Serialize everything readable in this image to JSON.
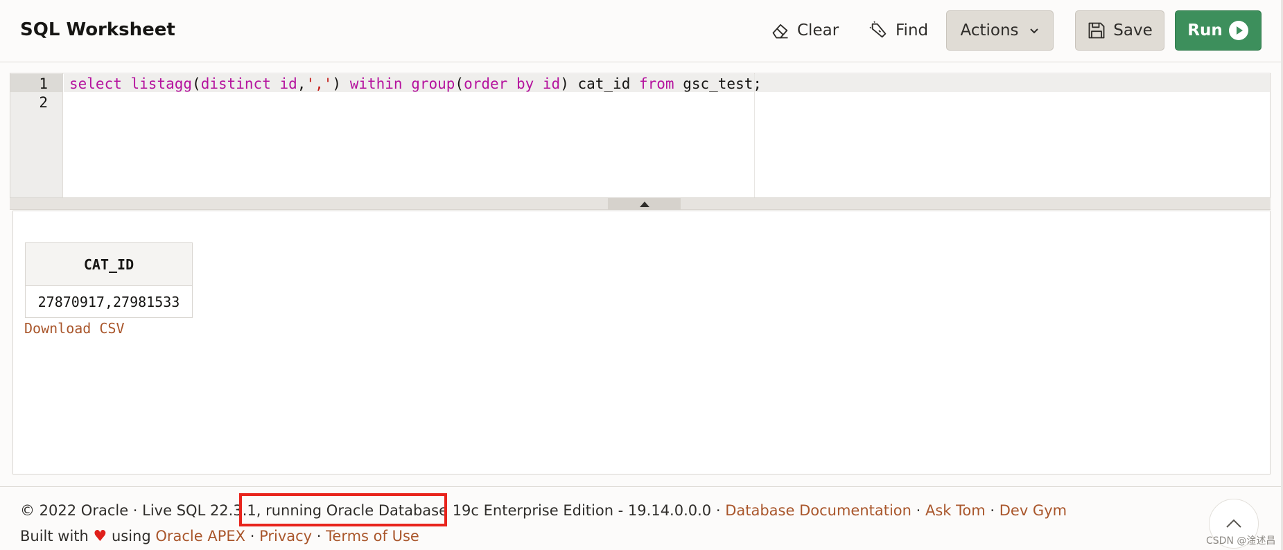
{
  "header": {
    "title": "SQL Worksheet",
    "clear_label": "Clear",
    "find_label": "Find",
    "actions_label": "Actions",
    "save_label": "Save",
    "run_label": "Run"
  },
  "editor": {
    "line_numbers": [
      "1",
      "2"
    ],
    "code_tokens": [
      {
        "text": "select",
        "type": "keyword"
      },
      {
        "text": " ",
        "type": "plain"
      },
      {
        "text": "listagg",
        "type": "keyword"
      },
      {
        "text": "(",
        "type": "plain"
      },
      {
        "text": "distinct",
        "type": "keyword"
      },
      {
        "text": " ",
        "type": "plain"
      },
      {
        "text": "id",
        "type": "keyword"
      },
      {
        "text": ",",
        "type": "plain"
      },
      {
        "text": "','",
        "type": "string"
      },
      {
        "text": ") ",
        "type": "plain"
      },
      {
        "text": "within",
        "type": "keyword"
      },
      {
        "text": " ",
        "type": "plain"
      },
      {
        "text": "group",
        "type": "keyword"
      },
      {
        "text": "(",
        "type": "plain"
      },
      {
        "text": "order",
        "type": "keyword"
      },
      {
        "text": " ",
        "type": "plain"
      },
      {
        "text": "by",
        "type": "keyword"
      },
      {
        "text": " ",
        "type": "plain"
      },
      {
        "text": "id",
        "type": "keyword"
      },
      {
        "text": ") cat_id ",
        "type": "plain"
      },
      {
        "text": "from",
        "type": "keyword"
      },
      {
        "text": " gsc_test;",
        "type": "plain"
      }
    ]
  },
  "results": {
    "columns": [
      "CAT_ID"
    ],
    "rows": [
      [
        "27870917,27981533"
      ]
    ],
    "download_label": "Download CSV"
  },
  "footer": {
    "copyright": "© 2022 Oracle · Live SQL 22.3.1, ",
    "running": "running Oracle Database 19c",
    "edition": " Enterprise Edition - 19.14.0.0.0 · ",
    "link_docs": "Database Documentation",
    "sep": " · ",
    "link_asktom": "Ask Tom",
    "link_devgym": "Dev Gym",
    "built_with": "Built with ",
    "heart": "♥",
    "using": " using ",
    "link_apex": "Oracle APEX",
    "link_privacy": "Privacy",
    "link_terms": "Terms of Use"
  },
  "watermark": "CSDN @淦述昌",
  "colors": {
    "run_button": "#3d8f5c",
    "link": "#a9562b",
    "keyword": "#b5139e",
    "string": "#c41a16",
    "highlight_box": "#e8241c"
  }
}
